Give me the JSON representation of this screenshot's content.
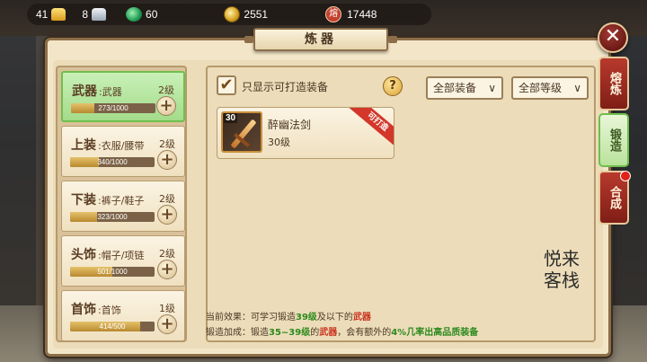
{
  "topbar": {
    "gold": "41",
    "silver": "8",
    "jade": "60",
    "coins": "2551",
    "rong_icon_label": "熔",
    "rong": "17448",
    "icons": [
      "gold-ingot-icon",
      "silver-ingot-icon",
      "jade-icon",
      "coin-icon",
      "rong-icon"
    ]
  },
  "panel": {
    "title": "炼器",
    "close_label": "✕"
  },
  "categories": [
    {
      "name": "武器",
      "sub": ":武器",
      "level": "2级",
      "progress_text": "273/1000",
      "progress": 0.273,
      "active": true
    },
    {
      "name": "上装",
      "sub": ":衣服/腰带",
      "level": "2级",
      "progress_text": "340/1000",
      "progress": 0.34,
      "active": false
    },
    {
      "name": "下装",
      "sub": ":裤子/鞋子",
      "level": "2级",
      "progress_text": "323/1000",
      "progress": 0.323,
      "active": false
    },
    {
      "name": "头饰",
      "sub": ":帽子/项链",
      "level": "2级",
      "progress_text": "501/1000",
      "progress": 0.501,
      "active": false
    },
    {
      "name": "首饰",
      "sub": ":首饰",
      "level": "1级",
      "progress_text": "414/500",
      "progress": 0.828,
      "active": false
    }
  ],
  "filters": {
    "checkbox_label": "只显示可打造装备",
    "checkbox_checked": true,
    "help": "?",
    "equip_dropdown": "全部装备",
    "level_dropdown": "全部等级"
  },
  "items": [
    {
      "name": "醉幽法剑",
      "level": "30级",
      "badge_level": "30",
      "ribbon": "可打造"
    }
  ],
  "effects": {
    "current_prefix": "当前效果：可学习锻造",
    "current_level": "39级",
    "current_mid": "及以下的",
    "current_type": "武器",
    "bonus_prefix": "锻造加成：锻造",
    "bonus_range": "35~39级",
    "bonus_mid": "的",
    "bonus_type": "武器",
    "bonus_suffix1": "，会有额外的",
    "bonus_rate": "4%几率出高品质装备"
  },
  "side_tabs": [
    {
      "label": "熔炼",
      "active": false
    },
    {
      "label": "锻造",
      "active": true
    },
    {
      "label": "合成",
      "active": false
    }
  ],
  "logo": {
    "line1": "悦来",
    "line2": "客栈"
  }
}
